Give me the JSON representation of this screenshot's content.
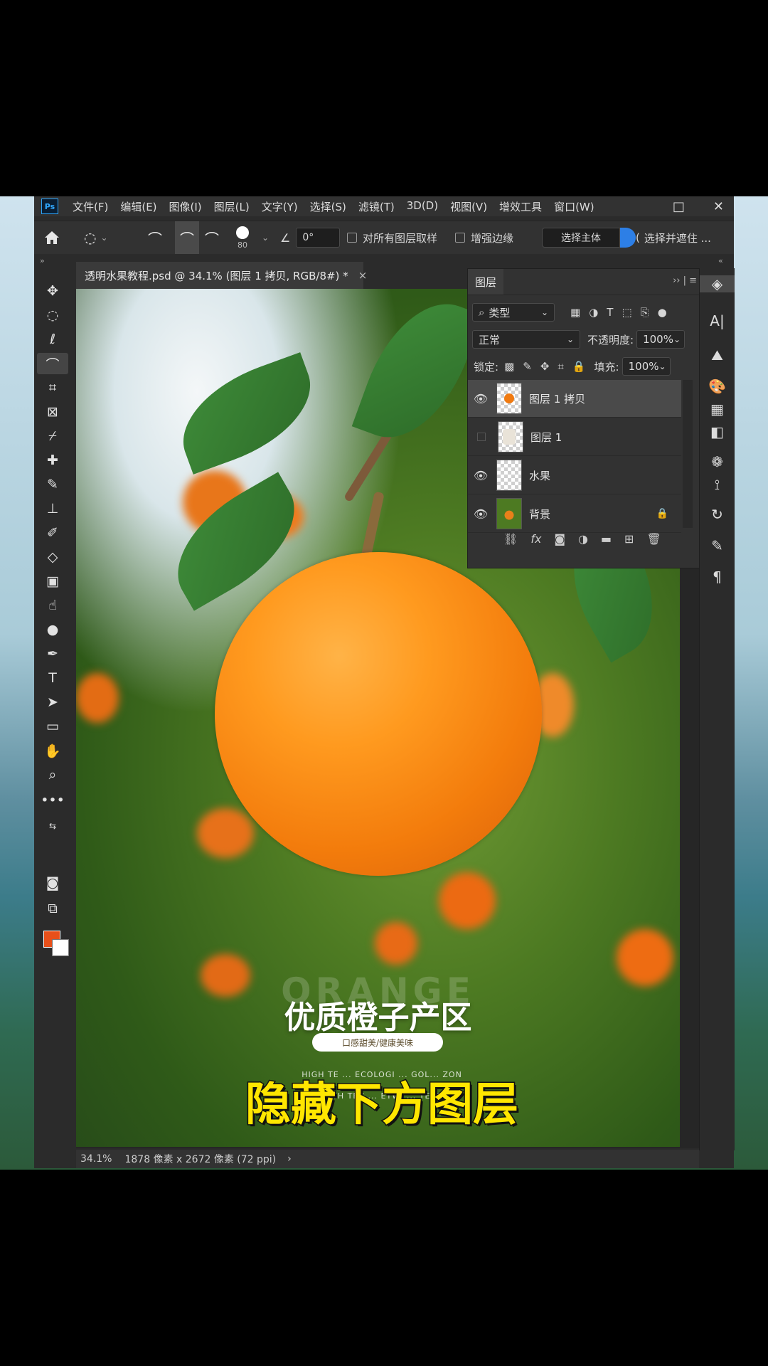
{
  "app": {
    "logo": "Ps",
    "menu": [
      "文件(F)",
      "编辑(E)",
      "图像(I)",
      "图层(L)",
      "文字(Y)",
      "选择(S)",
      "滤镜(T)",
      "3D(D)",
      "视图(V)",
      "增效工具",
      "窗口(W)"
    ],
    "window_controls": [
      "□",
      "✕"
    ]
  },
  "options_bar": {
    "brush_size": "80",
    "angle": "0°",
    "sample_all_layers": "对所有图层取样",
    "enhance_edge": "增强边缘",
    "select_subject": "选择主体",
    "select_and_mask": "选择并遮住 ..."
  },
  "document": {
    "tab_title": "透明水果教程.psd @ 34.1% (图层 1 拷贝, RGB/8#) *",
    "close": "×"
  },
  "artwork": {
    "watermark": "ORANGE",
    "headline": "优质橙子产区",
    "pill": "口感甜美/健康美味",
    "small_line_1": "HIGH TE ... ECOLOGI ... GOL... ZON",
    "small_line_2": "HIGH TEC ... ETWI ... TERS"
  },
  "subtitle": "隐藏下方图层",
  "layers_panel": {
    "tab": "图层",
    "filter_kind": "类型",
    "blend_mode": "正常",
    "opacity_label": "不透明度:",
    "opacity_value": "100%",
    "lock_label": "锁定:",
    "fill_label": "填充:",
    "fill_value": "100%",
    "layers": [
      {
        "name": "图层 1 拷贝",
        "visible": true,
        "selected": true
      },
      {
        "name": "图层 1",
        "visible": false,
        "selected": false
      },
      {
        "name": "水果",
        "visible": true,
        "selected": false
      },
      {
        "name": "背景",
        "visible": true,
        "selected": false,
        "locked": true
      }
    ]
  },
  "status": {
    "zoom": "34.1%",
    "dimensions": "1878 像素 x 2672 像素 (72 ppi)",
    "arrow": "›"
  },
  "colors": {
    "foreground": "#e8501a",
    "background": "#ffffff",
    "subtitle": "#ffe600"
  }
}
